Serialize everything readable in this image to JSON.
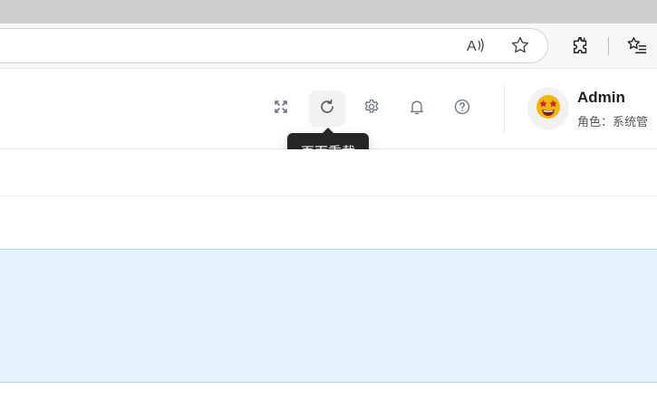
{
  "browser": {
    "icons": [
      "read-aloud-icon",
      "favorite-star-icon",
      "extensions-icon",
      "favorites-list-icon"
    ]
  },
  "header": {
    "tools": [
      {
        "name": "fullscreen-icon"
      },
      {
        "name": "reload-icon"
      },
      {
        "name": "settings-gear-icon"
      },
      {
        "name": "notification-bell-icon"
      },
      {
        "name": "help-icon"
      }
    ],
    "reload_tooltip": "页面重载",
    "user": {
      "name": "Admin",
      "role": "角色：系统管"
    }
  },
  "colors": {
    "tooltip_bg": "#262626",
    "highlight_bg": "#e6f3fd",
    "highlight_border": "#a9d4f2",
    "icon_gray": "#6b7280"
  }
}
